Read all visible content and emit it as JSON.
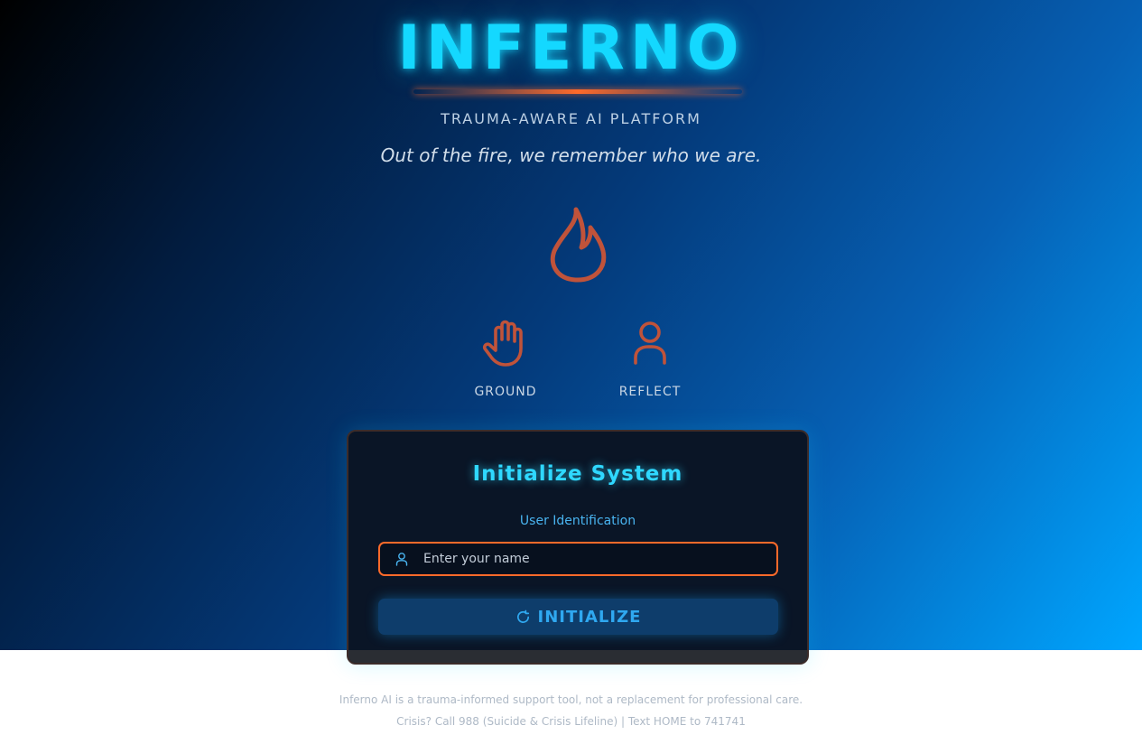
{
  "brand": {
    "title": "INFERNO",
    "subtitle": "TRAUMA-AWARE AI PLATFORM",
    "tagline": "Out of the fire, we remember who we are."
  },
  "hero_icon": "flame-icon",
  "modes": [
    {
      "label": "GROUND",
      "icon": "hand-icon"
    },
    {
      "label": "REFLECT",
      "icon": "user-icon"
    }
  ],
  "init_card": {
    "title": "Initialize System",
    "field_label": "User Identification",
    "name_input": {
      "placeholder": "Enter your name",
      "value": ""
    },
    "button_label": "INITIALIZE",
    "button_icon": "refresh-icon"
  },
  "footer": {
    "disclaimer": "Inferno AI is a trauma-informed support tool, not a replacement for professional care.",
    "crisis": "Crisis? Call 988 (Suicide & Crisis Lifeline) | Text HOME to 741741"
  },
  "colors": {
    "accent_cyan": "#14d8ff",
    "accent_orange": "#ff6a2a",
    "icon_orange": "#c0533a",
    "button_bg": "#0e3d6b"
  }
}
